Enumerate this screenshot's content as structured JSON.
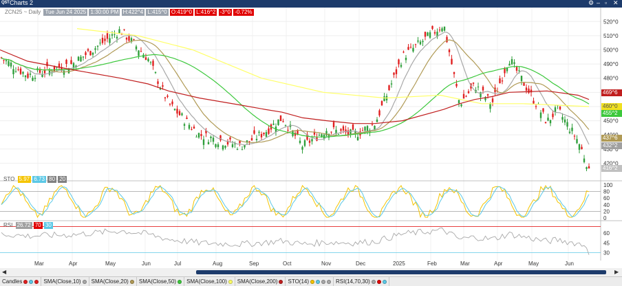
{
  "window": {
    "logo": "QST",
    "title": "Charts 2",
    "icons": [
      "settings-icon",
      "minimize-icon",
      "restore-icon",
      "close-icon"
    ]
  },
  "price_header": {
    "symbol": "ZCN25 ~ Daily",
    "date": "Tue Jun 24 2025",
    "time": "1:30:00 PM",
    "high": "H:422^4",
    "low": "L:415^0",
    "open": "O:419^0",
    "last": "L:416^2",
    "change": "-3^0",
    "change_pct": "-0.72%"
  },
  "sto_header": {
    "label": "STO",
    "values": [
      "5.97",
      "6.73",
      "80",
      "20"
    ],
    "colors": [
      "#f5c400",
      "#5bc8e6",
      "#808080",
      "#808080"
    ]
  },
  "rsi_header": {
    "label": "RSI",
    "values": [
      "26.72",
      "70",
      "30"
    ],
    "colors": [
      "#a0a0a0",
      "#e00000",
      "#5bc8e6"
    ]
  },
  "colors": {
    "up": "#2e9e3a",
    "down": "#e01f1f",
    "sma10": "#a8a8a8",
    "sma20": "#b09a55",
    "sma50": "#3cc83c",
    "sma100": "#ffff66",
    "sma200": "#c01e1e",
    "sto_k": "#f5c400",
    "sto_d": "#5bc8e6",
    "rsi": "#a8a8a8",
    "rsi_ob": "#e00000",
    "rsi_os": "#5bc8e6"
  },
  "chart_data": {
    "type": "candlestick",
    "symbol": "ZCN25",
    "interval": "Daily",
    "x_axis_labels": [
      "Mar",
      "Apr",
      "May",
      "Jun",
      "Jul",
      "Aug",
      "Sep",
      "Oct",
      "Nov",
      "Dec",
      "2025",
      "Feb",
      "Mar",
      "Apr",
      "May",
      "Jun"
    ],
    "y_axis_labels": [
      "520^0",
      "510^0",
      "500^0",
      "490^0",
      "480^0",
      "470^0",
      "460^0",
      "450^0",
      "440^0",
      "430^0",
      "420^0"
    ],
    "ylim": [
      410,
      525
    ],
    "close_path": [
      {
        "x": "Feb",
        "y": 495
      },
      {
        "x": "Mar",
        "y": 482
      },
      {
        "x": "Apr",
        "y": 490
      },
      {
        "x": "May",
        "y": 514
      },
      {
        "x": "Jun",
        "y": 494
      },
      {
        "x": "Jul",
        "y": 440
      },
      {
        "x": "Aug",
        "y": 432
      },
      {
        "x": "Sep",
        "y": 442
      },
      {
        "x": "Oct",
        "y": 452
      },
      {
        "x": "Oct",
        "y": 432
      },
      {
        "x": "Nov",
        "y": 444
      },
      {
        "x": "Dec",
        "y": 440
      },
      {
        "x": "2025",
        "y": 468
      },
      {
        "x": "2025",
        "y": 495
      },
      {
        "x": "Feb",
        "y": 518
      },
      {
        "x": "Mar",
        "y": 462
      },
      {
        "x": "Mar",
        "y": 475
      },
      {
        "x": "Apr",
        "y": 462
      },
      {
        "x": "Apr",
        "y": 494
      },
      {
        "x": "May",
        "y": 449
      },
      {
        "x": "May",
        "y": 458
      },
      {
        "x": "Jun",
        "y": 436
      },
      {
        "x": "Jun",
        "y": 416.25
      }
    ],
    "series": [
      {
        "name": "SMA(Close,10)",
        "last": "432^2"
      },
      {
        "name": "SMA(Close,20)",
        "last": "437^6"
      },
      {
        "name": "SMA(Close,50)",
        "last": "455^2"
      },
      {
        "name": "SMA(Close,100)",
        "last": "460^0"
      },
      {
        "name": "SMA(Close,200)",
        "last": "469^6"
      }
    ],
    "last_price": "416^2",
    "sto_axis_labels": [
      "100",
      "80",
      "60",
      "40",
      "20",
      "0"
    ],
    "sto_levels": [
      80,
      20
    ],
    "rsi_axis_labels": [
      "60",
      "45",
      "30"
    ],
    "rsi_levels": [
      70,
      30
    ]
  },
  "studies": [
    {
      "label": "Candles",
      "dots": [
        "#e01f1f",
        "#5bc8e6",
        "#e01f1f"
      ]
    },
    {
      "label": "SMA(Close,10)",
      "dots": [
        "#a8a8a8"
      ]
    },
    {
      "label": "SMA(Close,20)",
      "dots": [
        "#b09a55"
      ]
    },
    {
      "label": "SMA(Close,50)",
      "dots": [
        "#3cc83c"
      ]
    },
    {
      "label": "SMA(Close,100)",
      "dots": [
        "#ffff66"
      ]
    },
    {
      "label": "SMA(Close,200)",
      "dots": [
        "#c01e1e"
      ]
    },
    {
      "label": "STO(14)",
      "dots": [
        "#f5c400",
        "#5bc8e6",
        "#a8a8a8",
        "#a8a8a8"
      ]
    },
    {
      "label": "RSI(14,70,30)",
      "dots": [
        "#a8a8a8",
        "#e00000",
        "#5bc8e6"
      ]
    }
  ]
}
